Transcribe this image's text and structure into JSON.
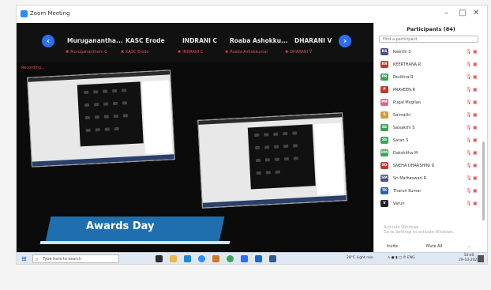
{
  "window": {
    "title": "Zoom Meeting",
    "minimize": "–",
    "restore": "□",
    "close": "✕"
  },
  "meeting": {
    "tiles": [
      {
        "name": "Muruganantha...",
        "sub": "Muruganantham C"
      },
      {
        "name": "KASC Erode",
        "sub": "KASC Erode"
      },
      {
        "name": "INDRANI C",
        "sub": "INDRANI C"
      },
      {
        "name": "Roaba  Ashokku...",
        "sub": "Roaba Ashokkumar"
      },
      {
        "name": "DHARANI V",
        "sub": "DHARANI V"
      }
    ],
    "prev": "‹",
    "next": "›",
    "recording": "Recording...",
    "banner_text": "Awards Day"
  },
  "participants": {
    "title": "Participants (84)",
    "search_placeholder": "Find a participant",
    "list": [
      {
        "initials": "KS",
        "name": "Keerthi S",
        "color": "#4b4f8a"
      },
      {
        "initials": "KR",
        "name": "KEERTHANA R",
        "color": "#c0392b"
      },
      {
        "initials": "PR",
        "name": "Pavithra R",
        "color": "#3fa05a"
      },
      {
        "initials": "P",
        "name": "PRAVEEN.R",
        "color": "#c0392b"
      },
      {
        "initials": "PM",
        "name": "Pugal Mugilan",
        "color": "#d06b8a"
      },
      {
        "initials": "S",
        "name": "Saimathi",
        "color": "#d39a3a"
      },
      {
        "initials": "SS",
        "name": "Saisakthi S",
        "color": "#3fa05a"
      },
      {
        "initials": "SS",
        "name": "Saran S",
        "color": "#3fa05a"
      },
      {
        "initials": "DM",
        "name": "Dakshitha M",
        "color": "#3fa05a"
      },
      {
        "initials": "SD",
        "name": "SNEHA DHARSHINI D",
        "color": "#c0392b"
      },
      {
        "initials": "SM",
        "name": "Sri Matheswari.R",
        "color": "#4b4f8a"
      },
      {
        "initials": "TK",
        "name": "Tharun Kumar",
        "color": "#2d5fa6"
      },
      {
        "initials": "V",
        "name": "Varun",
        "color": "#222233"
      }
    ],
    "mic_icon": "🎙",
    "cam_icon": "▣",
    "watermark_line1": "Activate Windows",
    "watermark_line2": "Go to Settings to activate Windows.",
    "invite": "Invite",
    "mute_all": "Mute All",
    "more": "..."
  },
  "taskbar": {
    "start_icon": "⊞",
    "search_icon": "⌕",
    "search_placeholder": "Type here to search",
    "weather": "28°C  Light rain",
    "tray_icons": "∧  ●  ▮  ▢  ✆  ENG",
    "time": "10:40",
    "date": "29-10-2021"
  }
}
